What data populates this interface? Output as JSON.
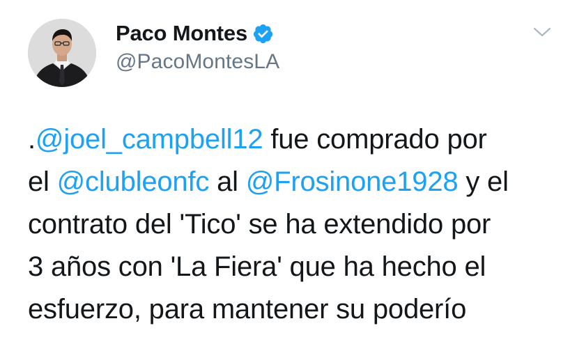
{
  "user": {
    "display_name": "Paco Montes",
    "handle": "@PacoMontesLA",
    "avatar_icon": "user-avatar-photo",
    "verified_icon": "verified-badge-icon"
  },
  "menu": {
    "caret_icon": "chevron-down-icon"
  },
  "tweet": {
    "line1": {
      "pre": ".",
      "mention": "@joel_campbell12",
      "post": " fue comprado por"
    },
    "line2": {
      "pre": "el ",
      "mention1": "@clubleonfc",
      "mid": " al ",
      "mention2": "@Frosinone1928",
      "post": " y el"
    },
    "line3": "contrato del 'Tico' se ha extendido por",
    "line4": "3 años con 'La Fiera' que ha hecho el",
    "line5": "esfuerzo, para mantener su poderío"
  },
  "colors": {
    "text": "#14171a",
    "secondary": "#657786",
    "accent": "#1da1f2"
  }
}
